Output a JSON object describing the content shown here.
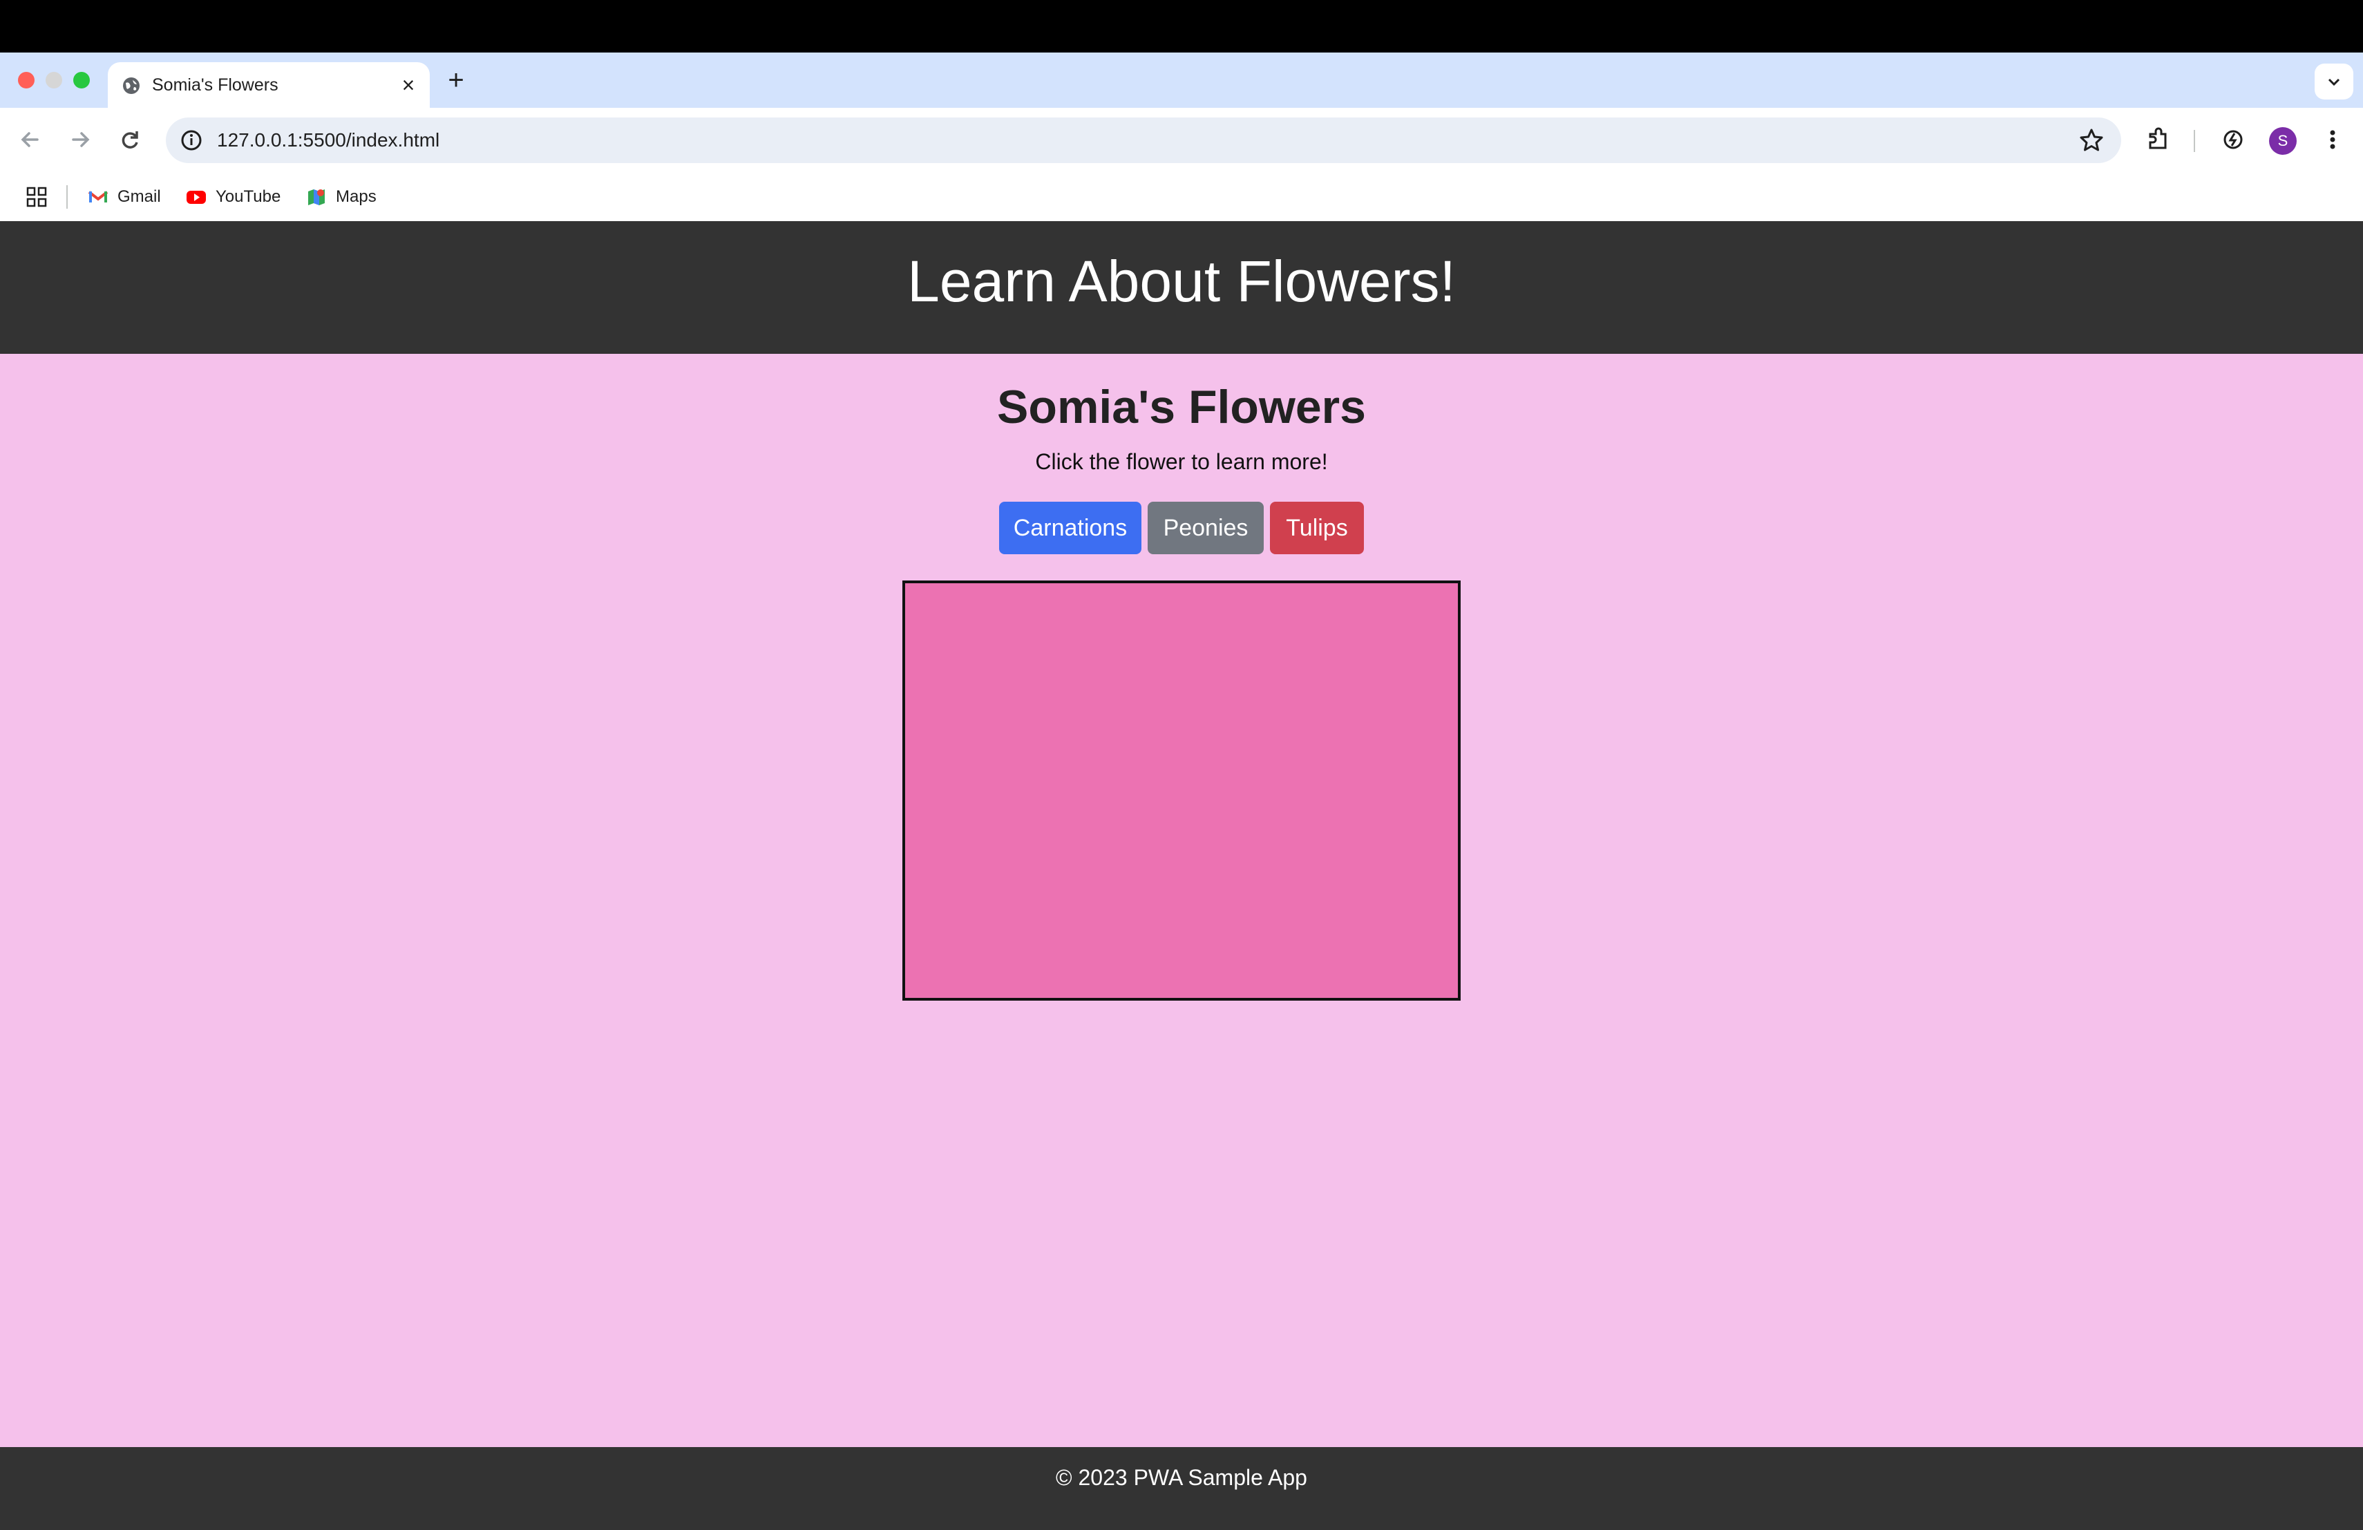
{
  "browser": {
    "tab": {
      "title": "Somia's Flowers",
      "close_icon": "close-icon",
      "favicon": "globe-icon"
    },
    "new_tab_label": "+",
    "address_bar": {
      "url": "127.0.0.1:5500/index.html"
    },
    "profile_initial": "S",
    "bookmarks": [
      {
        "label": "Gmail",
        "icon": "gmail-icon"
      },
      {
        "label": "YouTube",
        "icon": "youtube-icon"
      },
      {
        "label": "Maps",
        "icon": "maps-icon"
      }
    ]
  },
  "page": {
    "header_title": "Learn About Flowers!",
    "title": "Somia's Flowers",
    "subtitle": "Click the flower to learn more!",
    "buttons": {
      "carnations": "Carnations",
      "peonies": "Peonies",
      "tulips": "Tulips"
    },
    "footer": "© 2023 PWA Sample App"
  },
  "colors": {
    "header_bg": "#333333",
    "page_bg": "#f5c1eb",
    "flower_box": "#ec72b2",
    "carnations_btn": "#3d6ef2",
    "peonies_btn": "#717780",
    "tulips_btn": "#d0404e"
  }
}
